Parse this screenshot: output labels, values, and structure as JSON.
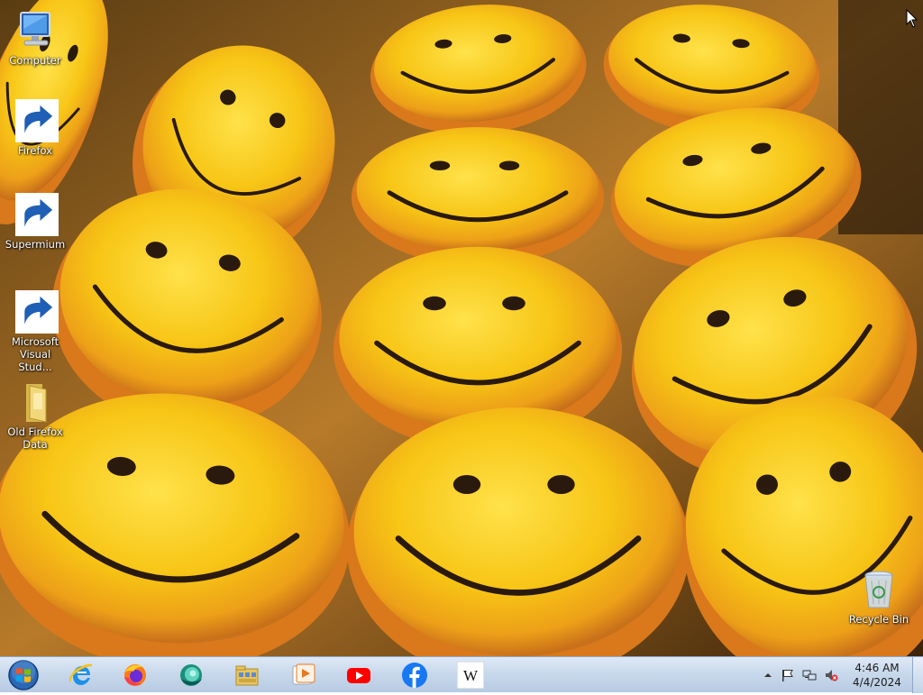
{
  "desktop": {
    "wallpaper": "smiley-face-donuts",
    "icons": [
      {
        "label": "Computer",
        "icon": "computer-icon"
      },
      {
        "label": "Firefox",
        "icon": "firefox-icon"
      },
      {
        "label": "Supermium",
        "icon": "supermium-icon"
      },
      {
        "label": "Microsoft Visual Stud...",
        "icon": "visual-studio-icon"
      },
      {
        "label": "Old Firefox Data",
        "icon": "folder-icon"
      },
      {
        "label": "Recycle Bin",
        "icon": "recycle-bin-icon"
      }
    ]
  },
  "taskbar": {
    "start": "windows-start-icon",
    "pinned": [
      {
        "name": "Internet Explorer",
        "icon": "internet-explorer-icon"
      },
      {
        "name": "Firefox",
        "icon": "firefox-icon"
      },
      {
        "name": "Supermium",
        "icon": "supermium-icon"
      },
      {
        "name": "File Explorer",
        "icon": "file-explorer-icon"
      },
      {
        "name": "Media Player",
        "icon": "media-player-icon"
      },
      {
        "name": "YouTube",
        "icon": "youtube-icon"
      },
      {
        "name": "Facebook",
        "icon": "facebook-icon"
      },
      {
        "name": "Wikipedia",
        "icon": "wikipedia-icon",
        "glyph": "W"
      }
    ],
    "tray": {
      "icons": [
        "show-hidden-icons-arrow",
        "action-center-flag-icon",
        "network-icon",
        "volume-muted-icon"
      ],
      "time": "4:46 AM",
      "date": "4/4/2024"
    }
  },
  "colors": {
    "taskbar_top": "#dfe9f5",
    "taskbar_bottom": "#b7cbe3",
    "donut_yellow": "#f7c515",
    "donut_orange": "#e8861a"
  }
}
